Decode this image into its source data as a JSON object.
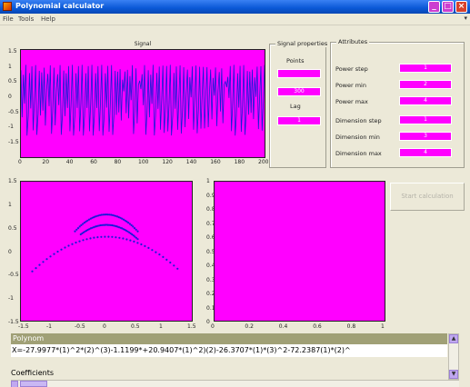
{
  "window": {
    "title": "Polynomial calculator"
  },
  "menu": {
    "items": [
      "File",
      "Tools",
      "Help"
    ],
    "chevron": "▾"
  },
  "signal_plot": {
    "title": "Signal",
    "y_ticks": [
      "1.5",
      "1",
      "0.5",
      "0",
      "-0.5",
      "-1",
      "-1.5"
    ],
    "x_ticks": [
      "0",
      "20",
      "40",
      "60",
      "80",
      "100",
      "120",
      "140",
      "160",
      "180",
      "200"
    ]
  },
  "signal_properties": {
    "title": "Signal properties",
    "points_label": "Points",
    "points_value": "300",
    "lag_label": "Lag",
    "lag_value": "1",
    "top_value": ""
  },
  "attributes": {
    "title": "Attributes",
    "power_step_label": "Power step",
    "power_step_value": "1",
    "power_min_label": "Power min",
    "power_min_value": "2",
    "power_max_label": "Power max",
    "power_max_value": "4",
    "dimension_step_label": "Dimension step",
    "dimension_step_value": "1",
    "dimension_min_label": "Dimension min",
    "dimension_min_value": "3",
    "dimension_max_label": "Dimension max",
    "dimension_max_value": "4"
  },
  "phase_plot": {
    "y_ticks": [
      "1.5",
      "1",
      "0.5",
      "0",
      "-0.5",
      "-1",
      "-1.5"
    ],
    "x_ticks": [
      "-1.5",
      "-1",
      "-0.5",
      "0",
      "0.5",
      "1",
      "1.5"
    ]
  },
  "empty_plot": {
    "y_ticks": [
      "1",
      "0.9",
      "0.8",
      "0.7",
      "0.6",
      "0.5",
      "0.4",
      "0.3",
      "0.2",
      "0.1",
      "0"
    ],
    "x_ticks": [
      "0",
      "0.2",
      "0.4",
      "0.6",
      "0.8",
      "1"
    ]
  },
  "start_button": {
    "label": "Start calculation"
  },
  "results": {
    "polynom_label": "Polynom",
    "polynom_text": "X=-27.9977*(1)^2*(2)^(3)-1.1199*+20.9407*(1)^2)(2)-26.3707*(1)*(3)^2-72.2387(1)*(2)^",
    "coefficients_label": "Coefficients"
  },
  "colors": {
    "plot_bg": "#ff00ff",
    "series": "#1a1ad8",
    "title_bar": "#0a58d6"
  }
}
